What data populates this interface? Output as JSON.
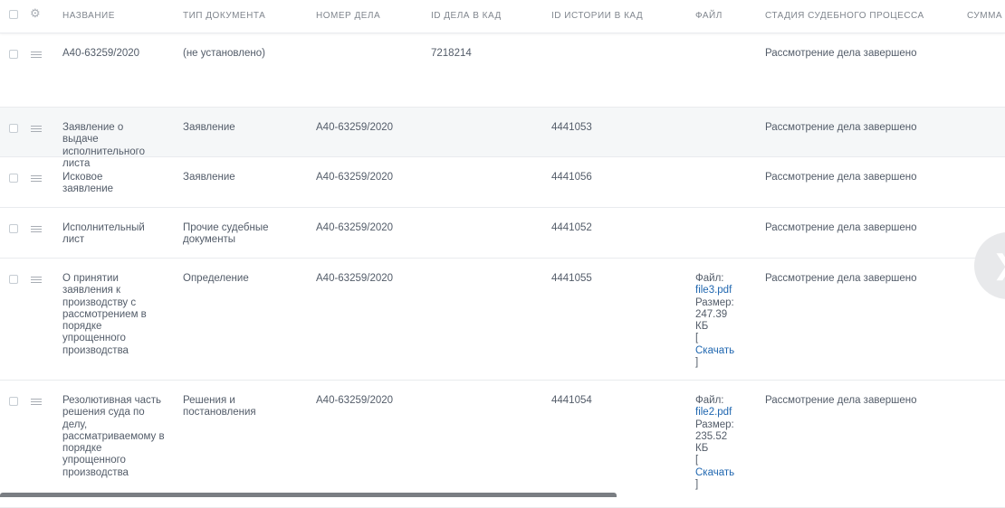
{
  "columns": {
    "name": "НАЗВАНИЕ",
    "doc_type": "ТИП ДОКУМЕНТА",
    "case_no": "НОМЕР ДЕЛА",
    "case_id": "ID ДЕЛА В КАД",
    "history_id": "ID ИСТОРИИ В КАД",
    "file": "ФАЙЛ",
    "stage": "СТАДИЯ СУДЕБНОГО ПРОЦЕССА",
    "sum": "СУММА"
  },
  "rows": [
    {
      "name": "А40-63259/2020",
      "doc_type": "(не установлено)",
      "case_no": "",
      "case_id": "7218214",
      "history_id": "",
      "stage": "Рассмотрение дела завершено"
    },
    {
      "name": "Заявление о выдаче исполнительного листа",
      "doc_type": "Заявление",
      "case_no": "А40-63259/2020",
      "case_id": "",
      "history_id": "4441053",
      "stage": "Рассмотрение дела завершено"
    },
    {
      "name": "Исковое заявление",
      "doc_type": "Заявление",
      "case_no": "А40-63259/2020",
      "case_id": "",
      "history_id": "4441056",
      "stage": "Рассмотрение дела завершено"
    },
    {
      "name": "Исполнительный лист",
      "doc_type": "Прочие судебные документы",
      "case_no": "А40-63259/2020",
      "case_id": "",
      "history_id": "4441052",
      "stage": "Рассмотрение дела завершено"
    },
    {
      "name": "О принятии заявления к производству с рассмотрением в порядке упрощенного производства",
      "doc_type": "Определение",
      "case_no": "А40-63259/2020",
      "case_id": "",
      "history_id": "4441055",
      "stage": "Рассмотрение дела завершено",
      "file": {
        "file_label": "Файл:",
        "file_name": "file3.pdf",
        "size_label": "Размер:",
        "size_value": "247.39",
        "size_unit": "КБ",
        "open_bracket": "[",
        "download": "Скачать",
        "close_bracket": "]"
      }
    },
    {
      "name": "Резолютивная часть решения суда по делу, рассматриваемому в порядке упрощенного производства",
      "doc_type": "Решения и постановления",
      "case_no": "А40-63259/2020",
      "case_id": "",
      "history_id": "4441054",
      "stage": "Рассмотрение дела завершено",
      "file": {
        "file_label": "Файл:",
        "file_name": "file2.pdf",
        "size_label": "Размер:",
        "size_value": "235.52",
        "size_unit": "КБ",
        "open_bracket": "[",
        "download": "Скачать",
        "close_bracket": "]"
      }
    }
  ],
  "icons": {
    "settings": "gear-icon",
    "drag": "drag-handle-icon",
    "next": "chevron-right-icon"
  },
  "colors": {
    "link": "#2067b0",
    "text": "#535c69",
    "header_text": "#80868e",
    "row_alt": "#f5f7f8"
  }
}
